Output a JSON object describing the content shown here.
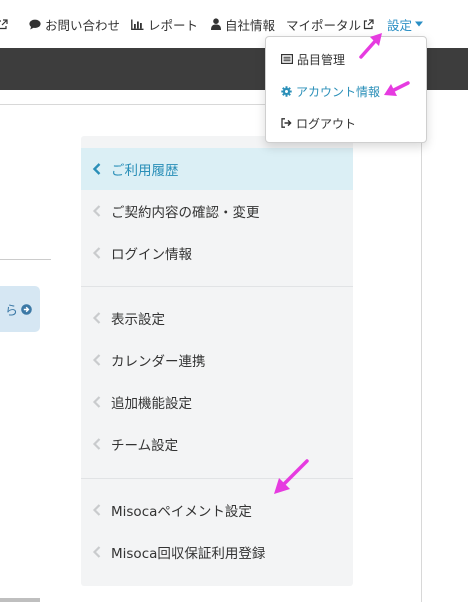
{
  "nav": {
    "contact": "お問い合わせ",
    "report": "レポート",
    "company": "自社情報",
    "portal": "マイポータル",
    "settings": "設定"
  },
  "dropdown": {
    "items": [
      {
        "label": "品目管理",
        "icon": "list-icon"
      },
      {
        "label": "アカウント情報",
        "icon": "gear-icon"
      },
      {
        "label": "ログアウト",
        "icon": "sign-out-icon"
      }
    ]
  },
  "left_box": {
    "text": "ら"
  },
  "side_menu": {
    "items": [
      {
        "label": "ご利用履歴",
        "active": true
      },
      {
        "label": "ご契約内容の確認・変更"
      },
      {
        "label": "ログイン情報"
      },
      {
        "label": "表示設定"
      },
      {
        "label": "カレンダー連携"
      },
      {
        "label": "追加機能設定"
      },
      {
        "label": "チーム設定"
      },
      {
        "label": "Misocaペイメント設定"
      },
      {
        "label": "Misoca回収保証利用登録"
      }
    ]
  },
  "colors": {
    "accent": "#2b8fc4",
    "active_bg": "#dbeff5",
    "dark_bar": "#3d3d3d",
    "annotation": "#e63be0"
  }
}
